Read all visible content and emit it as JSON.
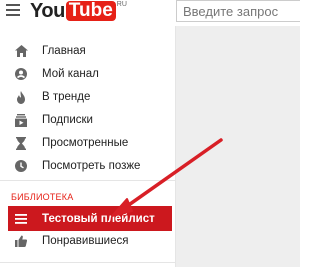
{
  "header": {
    "logo_you": "You",
    "logo_tube": "Tube",
    "logo_region": "RU",
    "search_placeholder": "Введите запрос"
  },
  "sidebar": {
    "items": [
      {
        "label": "Главная",
        "icon": "home-icon"
      },
      {
        "label": "Мой канал",
        "icon": "account-icon"
      },
      {
        "label": "В тренде",
        "icon": "flame-icon"
      },
      {
        "label": "Подписки",
        "icon": "subscriptions-icon"
      },
      {
        "label": "Просмотренные",
        "icon": "hourglass-icon"
      },
      {
        "label": "Посмотреть позже",
        "icon": "clock-icon"
      }
    ],
    "library_title": "БИБЛИОТЕКА",
    "library_items": [
      {
        "label": "Тестовый плейлист",
        "icon": "playlist-icon",
        "active": true
      },
      {
        "label": "Понравившиеся",
        "icon": "thumbs-up-icon",
        "active": false
      }
    ]
  },
  "colors": {
    "accent": "#e62117",
    "active_bg": "#cc181e",
    "arrow": "#d81f26"
  }
}
